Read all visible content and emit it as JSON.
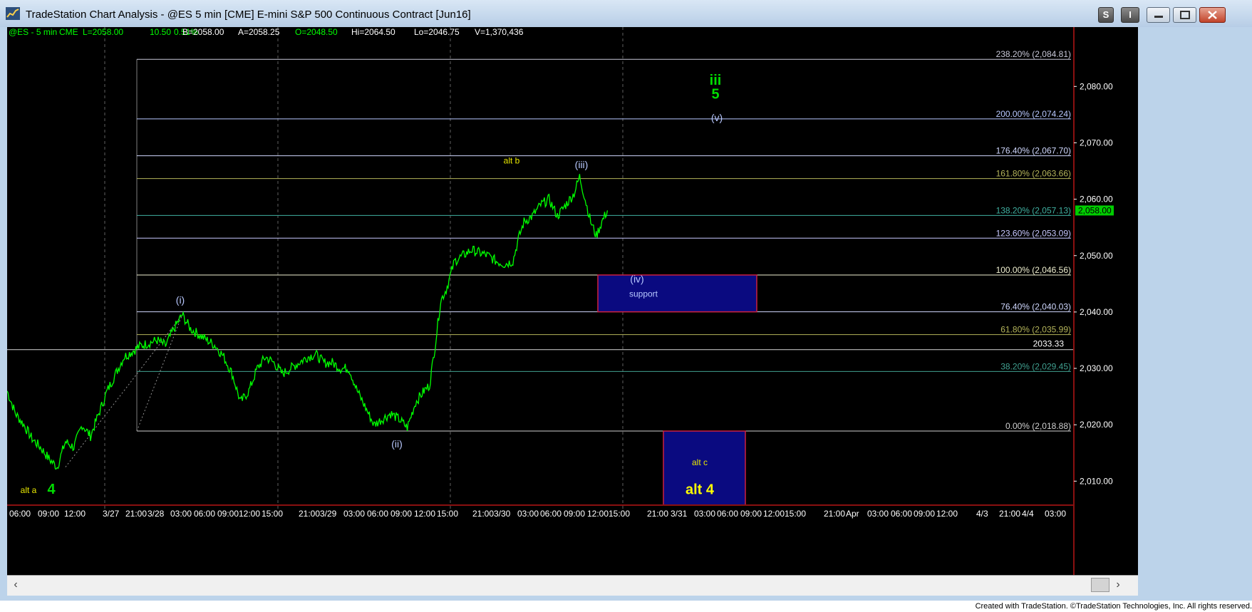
{
  "window": {
    "title": "TradeStation Chart Analysis - @ES 5 min [CME] E-mini S&P 500 Continuous Contract [Jun16]",
    "buttons": {
      "s": "S",
      "i": "I"
    }
  },
  "header": {
    "symbol": "@ES - 5 min",
    "exchange": "CME",
    "last": "L=2058.00",
    "change": "10.50",
    "change_pct": "0.51%",
    "bid": "B=2058.00",
    "ask": "A=2058.25",
    "open": "O=2048.50",
    "high": "Hi=2064.50",
    "low": "Lo=2046.75",
    "volume": "V=1,370,436"
  },
  "chart_data": {
    "type": "line",
    "series": [
      {
        "name": "@ES - 5 min",
        "color": "#00ff00",
        "points": [
          [
            0,
            2026
          ],
          [
            3,
            2022
          ],
          [
            6,
            2020
          ],
          [
            9,
            2017.5
          ],
          [
            12,
            2016
          ],
          [
            15,
            2014
          ],
          [
            18,
            2012.5
          ],
          [
            21,
            2017
          ],
          [
            24,
            2016
          ],
          [
            27,
            2020
          ],
          [
            30,
            2018
          ],
          [
            33,
            2022
          ],
          [
            36,
            2026
          ],
          [
            39,
            2029
          ],
          [
            42,
            2032
          ],
          [
            45,
            2033
          ],
          [
            48,
            2034
          ],
          [
            51,
            2034.5
          ],
          [
            54,
            2035
          ],
          [
            57,
            2034
          ],
          [
            60,
            2037
          ],
          [
            63,
            2039.5
          ],
          [
            66,
            2037
          ],
          [
            69,
            2036
          ],
          [
            72,
            2035
          ],
          [
            75,
            2034
          ],
          [
            78,
            2032
          ],
          [
            81,
            2029
          ],
          [
            84,
            2024
          ],
          [
            87,
            2026
          ],
          [
            90,
            2030
          ],
          [
            93,
            2032
          ],
          [
            96,
            2031
          ],
          [
            99,
            2029
          ],
          [
            102,
            2030
          ],
          [
            105,
            2031
          ],
          [
            108,
            2032
          ],
          [
            111,
            2032.5
          ],
          [
            114,
            2031
          ],
          [
            117,
            2031
          ],
          [
            120,
            2030
          ],
          [
            123,
            2030
          ],
          [
            126,
            2026
          ],
          [
            129,
            2023
          ],
          [
            132,
            2020
          ],
          [
            135,
            2021
          ],
          [
            138,
            2022
          ],
          [
            141,
            2021
          ],
          [
            144,
            2019.5
          ],
          [
            147,
            2024
          ],
          [
            150,
            2026
          ],
          [
            152,
            2027
          ],
          [
            154,
            2034
          ],
          [
            156,
            2042
          ],
          [
            158,
            2044
          ],
          [
            161,
            2049
          ],
          [
            164,
            2050
          ],
          [
            167,
            2051
          ],
          [
            170,
            2050.5
          ],
          [
            173,
            2050
          ],
          [
            176,
            2049
          ],
          [
            179,
            2048.5
          ],
          [
            182,
            2049
          ],
          [
            184,
            2053
          ],
          [
            186,
            2056
          ],
          [
            189,
            2057
          ],
          [
            192,
            2059
          ],
          [
            195,
            2060
          ],
          [
            198,
            2057
          ],
          [
            201,
            2059
          ],
          [
            204,
            2061
          ],
          [
            206,
            2064
          ],
          [
            208,
            2060
          ],
          [
            210,
            2056
          ],
          [
            212,
            2053.5
          ],
          [
            214,
            2056
          ],
          [
            216,
            2058
          ]
        ]
      }
    ],
    "x_tick_labels": [
      "06:00",
      "09:00",
      "12:00",
      "3/27",
      "21:00",
      "3/28",
      "03:00",
      "06:00",
      "09:00",
      "12:00",
      "15:00",
      "21:00",
      "3/29",
      "03:00",
      "06:00",
      "09:00",
      "12:00",
      "15:00",
      "21:00",
      "3/30",
      "03:00",
      "06:00",
      "09:00",
      "12:00",
      "15:00",
      "21:00",
      "3/31",
      "03:00",
      "06:00",
      "09:00",
      "12:00",
      "15:00",
      "21:00",
      "Apr",
      "03:00",
      "06:00",
      "09:00",
      "12:00",
      "4/3",
      "21:00",
      "4/4",
      "03:00"
    ],
    "y_tick_labels": [
      "2,080.00",
      "2,070.00",
      "2,060.00",
      "2,050.00",
      "2,040.00",
      "2,030.00",
      "2,020.00",
      "2,010.00"
    ],
    "ylim": [
      2006,
      2088
    ],
    "last_price": "2,058.00",
    "fib_levels": [
      {
        "label": "238.20% (2,084.81)",
        "value": 2084.81,
        "color": "#c8c8d8"
      },
      {
        "label": "200.00% (2,074.24)",
        "value": 2074.24,
        "color": "#b8c8ff"
      },
      {
        "label": "176.40% (2,067.70)",
        "value": 2067.7,
        "color": "#d0d8ff"
      },
      {
        "label": "161.80% (2,063.66)",
        "value": 2063.66,
        "color": "#b4b45a"
      },
      {
        "label": "138.20% (2,057.13)",
        "value": 2057.13,
        "color": "#40b0a0"
      },
      {
        "label": "123.60% (2,053.09)",
        "value": 2053.09,
        "color": "#c8c8ff"
      },
      {
        "label": "100.00% (2,046.56)",
        "value": 2046.56,
        "color": "#f0f0d0"
      },
      {
        "label": "76.40% (2,040.03)",
        "value": 2040.03,
        "color": "#d0d8ff"
      },
      {
        "label": "61.80% (2,035.99)",
        "value": 2035.99,
        "color": "#b4b45a"
      },
      {
        "label": "38.20% (2,029.45)",
        "value": 2029.45,
        "color": "#40a090"
      },
      {
        "label": "0.00% (2,018.88)",
        "value": 2018.88,
        "color": "#d0d0d0"
      }
    ],
    "horizontal_line": {
      "label": "2033.33",
      "value": 2033.33
    },
    "wave_labels": [
      {
        "text": "(i)",
        "color": "#b8c8ff"
      },
      {
        "text": "(ii)",
        "color": "#b8c8ff"
      },
      {
        "text": "(iii)",
        "color": "#b8c8ff"
      },
      {
        "text": "(iv)",
        "color": "#b8c8ff"
      },
      {
        "text": "(v)",
        "color": "#b8c8ff"
      },
      {
        "text": "iii",
        "color": "#00dd00"
      },
      {
        "text": "5",
        "color": "#00dd00"
      },
      {
        "text": "4",
        "color": "#00dd00"
      },
      {
        "text": "alt a",
        "color": "#e8e800"
      },
      {
        "text": "alt b",
        "color": "#e8e800"
      },
      {
        "text": "alt c",
        "color": "#e8e800"
      },
      {
        "text": "alt 4",
        "color": "#ffff00"
      },
      {
        "text": "support",
        "color": "#b8c8ff"
      }
    ]
  },
  "footer": {
    "copyright": "Created with TradeStation. ©TradeStation Technologies, Inc. All rights reserved."
  }
}
